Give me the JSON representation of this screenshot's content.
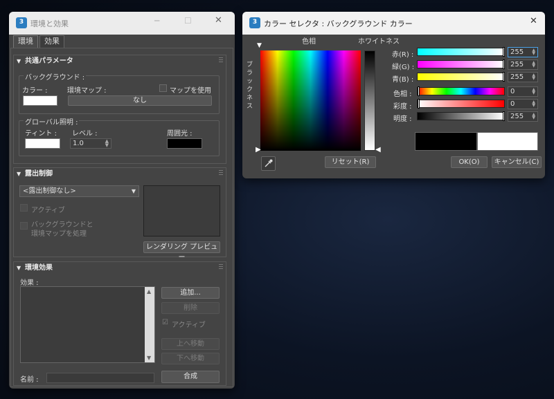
{
  "env_window": {
    "title": "環境と効果",
    "tabs": [
      "環境",
      "効果"
    ],
    "common_params": {
      "header": "共通パラメータ",
      "background_group": "バックグラウンド :",
      "color_label": "カラー :",
      "env_map_label": "環境マップ :",
      "use_map_label": "マップを使用",
      "map_button": "なし",
      "global_lighting_group": "グローバル照明 :",
      "tint_label": "ティント :",
      "level_label": "レベル :",
      "level_value": "1.0",
      "ambient_label": "周囲光 :"
    },
    "exposure": {
      "header": "露出制御",
      "dropdown_value": "<露出制御なし>",
      "active_label": "アクティブ",
      "process_bg_line1": "バックグラウンドと",
      "process_bg_line2": "環境マップを処理",
      "render_preview_button": "レンダリング プレビュー"
    },
    "atmosphere": {
      "header": "環境効果",
      "effects_label": "効果 :",
      "add_button": "追加...",
      "delete_button": "削除",
      "active_label": "アクティブ",
      "move_up_button": "上へ移動",
      "move_down_button": "下へ移動",
      "name_label": "名前 :",
      "merge_button": "合成"
    }
  },
  "color_window": {
    "title": "カラー セレクタ : バックグラウンド カラー",
    "hue_label": "色相",
    "whiteness_label": "ホワイトネス",
    "blackness_label": "ブラックネス",
    "reset_button": "リセット(R)",
    "ok_button": "OK(O)",
    "cancel_button": "キャンセル(C)",
    "channels": [
      {
        "label": "赤(R) :",
        "value": "255",
        "fill": 1.0
      },
      {
        "label": "緑(G) :",
        "value": "255",
        "fill": 1.0
      },
      {
        "label": "青(B) :",
        "value": "255",
        "fill": 1.0
      }
    ],
    "hsv": [
      {
        "label": "色相 :",
        "value": "0",
        "fill": 0.0
      },
      {
        "label": "彩度 :",
        "value": "0",
        "fill": 0.0
      },
      {
        "label": "明度 :",
        "value": "255",
        "fill": 1.0
      }
    ],
    "old_color": "#000000",
    "new_color": "#ffffff",
    "accent": "#2b7dc0"
  },
  "icons": {
    "app": "3ds-max-logo",
    "minimize": "─",
    "maximize": "☐",
    "close": "✕",
    "eyedropper": "eyedropper-icon"
  }
}
